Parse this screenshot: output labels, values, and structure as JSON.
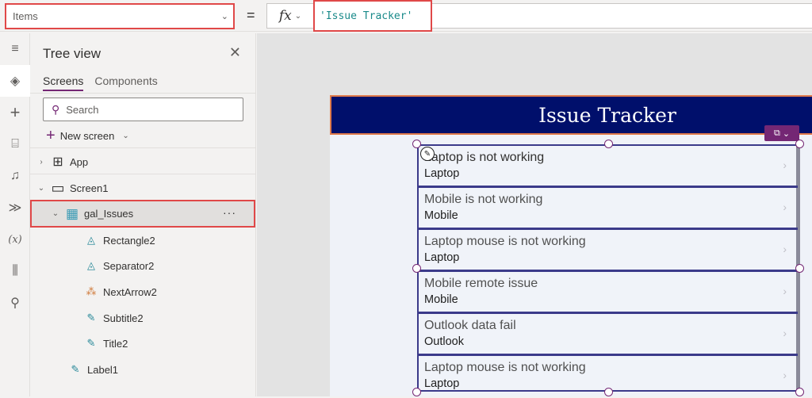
{
  "formula_bar": {
    "property": "Items",
    "equals": "=",
    "fx_label": "fx",
    "formula": "'Issue Tracker'"
  },
  "rail": {
    "items": [
      {
        "icon": "hamburger-menu-icon",
        "glyph": "≡"
      },
      {
        "icon": "layers-icon",
        "glyph": "◈",
        "active": true
      },
      {
        "icon": "insert-plus-icon",
        "glyph": "+"
      },
      {
        "icon": "data-cylinder-icon",
        "glyph": "⌸"
      },
      {
        "icon": "media-icon",
        "glyph": "♫"
      },
      {
        "icon": "power-automate-icon",
        "glyph": "≫"
      },
      {
        "icon": "variables-icon",
        "glyph": "(x)"
      },
      {
        "icon": "advanced-tools-icon",
        "glyph": "⫼"
      },
      {
        "icon": "search-icon",
        "glyph": "⚲"
      }
    ]
  },
  "tree_view": {
    "title": "Tree view",
    "close_glyph": "✕",
    "tabs": [
      {
        "label": "Screens",
        "active": true
      },
      {
        "label": "Components",
        "active": false
      }
    ],
    "search_placeholder": "Search",
    "new_screen_label": "New screen",
    "nodes": [
      {
        "label": "App",
        "caret": "›",
        "icon": "app-icon",
        "glyph": "⊞"
      },
      {
        "label": "Screen1",
        "caret": "⌄",
        "icon": "screen-icon",
        "glyph": "▭"
      },
      {
        "label": "gal_Issues",
        "caret": "⌄",
        "icon": "gallery-icon",
        "glyph": "▦",
        "selected": true,
        "more": "···"
      },
      {
        "label": "Rectangle2",
        "icon": "shape-icon",
        "glyph": "◬"
      },
      {
        "label": "Separator2",
        "icon": "shape-icon",
        "glyph": "◬"
      },
      {
        "label": "NextArrow2",
        "icon": "icons-control-icon",
        "glyph": "⁂"
      },
      {
        "label": "Subtitle2",
        "icon": "label-edit-icon",
        "glyph": "✎"
      },
      {
        "label": "Title2",
        "icon": "label-edit-icon",
        "glyph": "✎"
      },
      {
        "label": "Label1",
        "icon": "label-edit-icon",
        "glyph": "✎"
      }
    ]
  },
  "app": {
    "header_title": "Issue Tracker",
    "gallery": {
      "items": [
        {
          "title": "Laptop is not working",
          "subtitle": "Laptop"
        },
        {
          "title": "Mobile is not working",
          "subtitle": "Mobile"
        },
        {
          "title": "Laptop mouse is not working",
          "subtitle": "Laptop"
        },
        {
          "title": "Mobile remote issue",
          "subtitle": "Mobile"
        },
        {
          "title": "Outlook data fail",
          "subtitle": "Outlook"
        },
        {
          "title": "Laptop mouse is not working",
          "subtitle": "Laptop"
        }
      ],
      "arrow_glyph": "›"
    },
    "ai_chip_glyph": "⧉",
    "ai_chip_chevron": "⌄",
    "edit_badge_glyph": "✎"
  },
  "colors": {
    "header_bg": "#000f6b",
    "accent": "#742774",
    "highlight_border": "#e04848",
    "gallery_border": "#3b3a8a"
  }
}
